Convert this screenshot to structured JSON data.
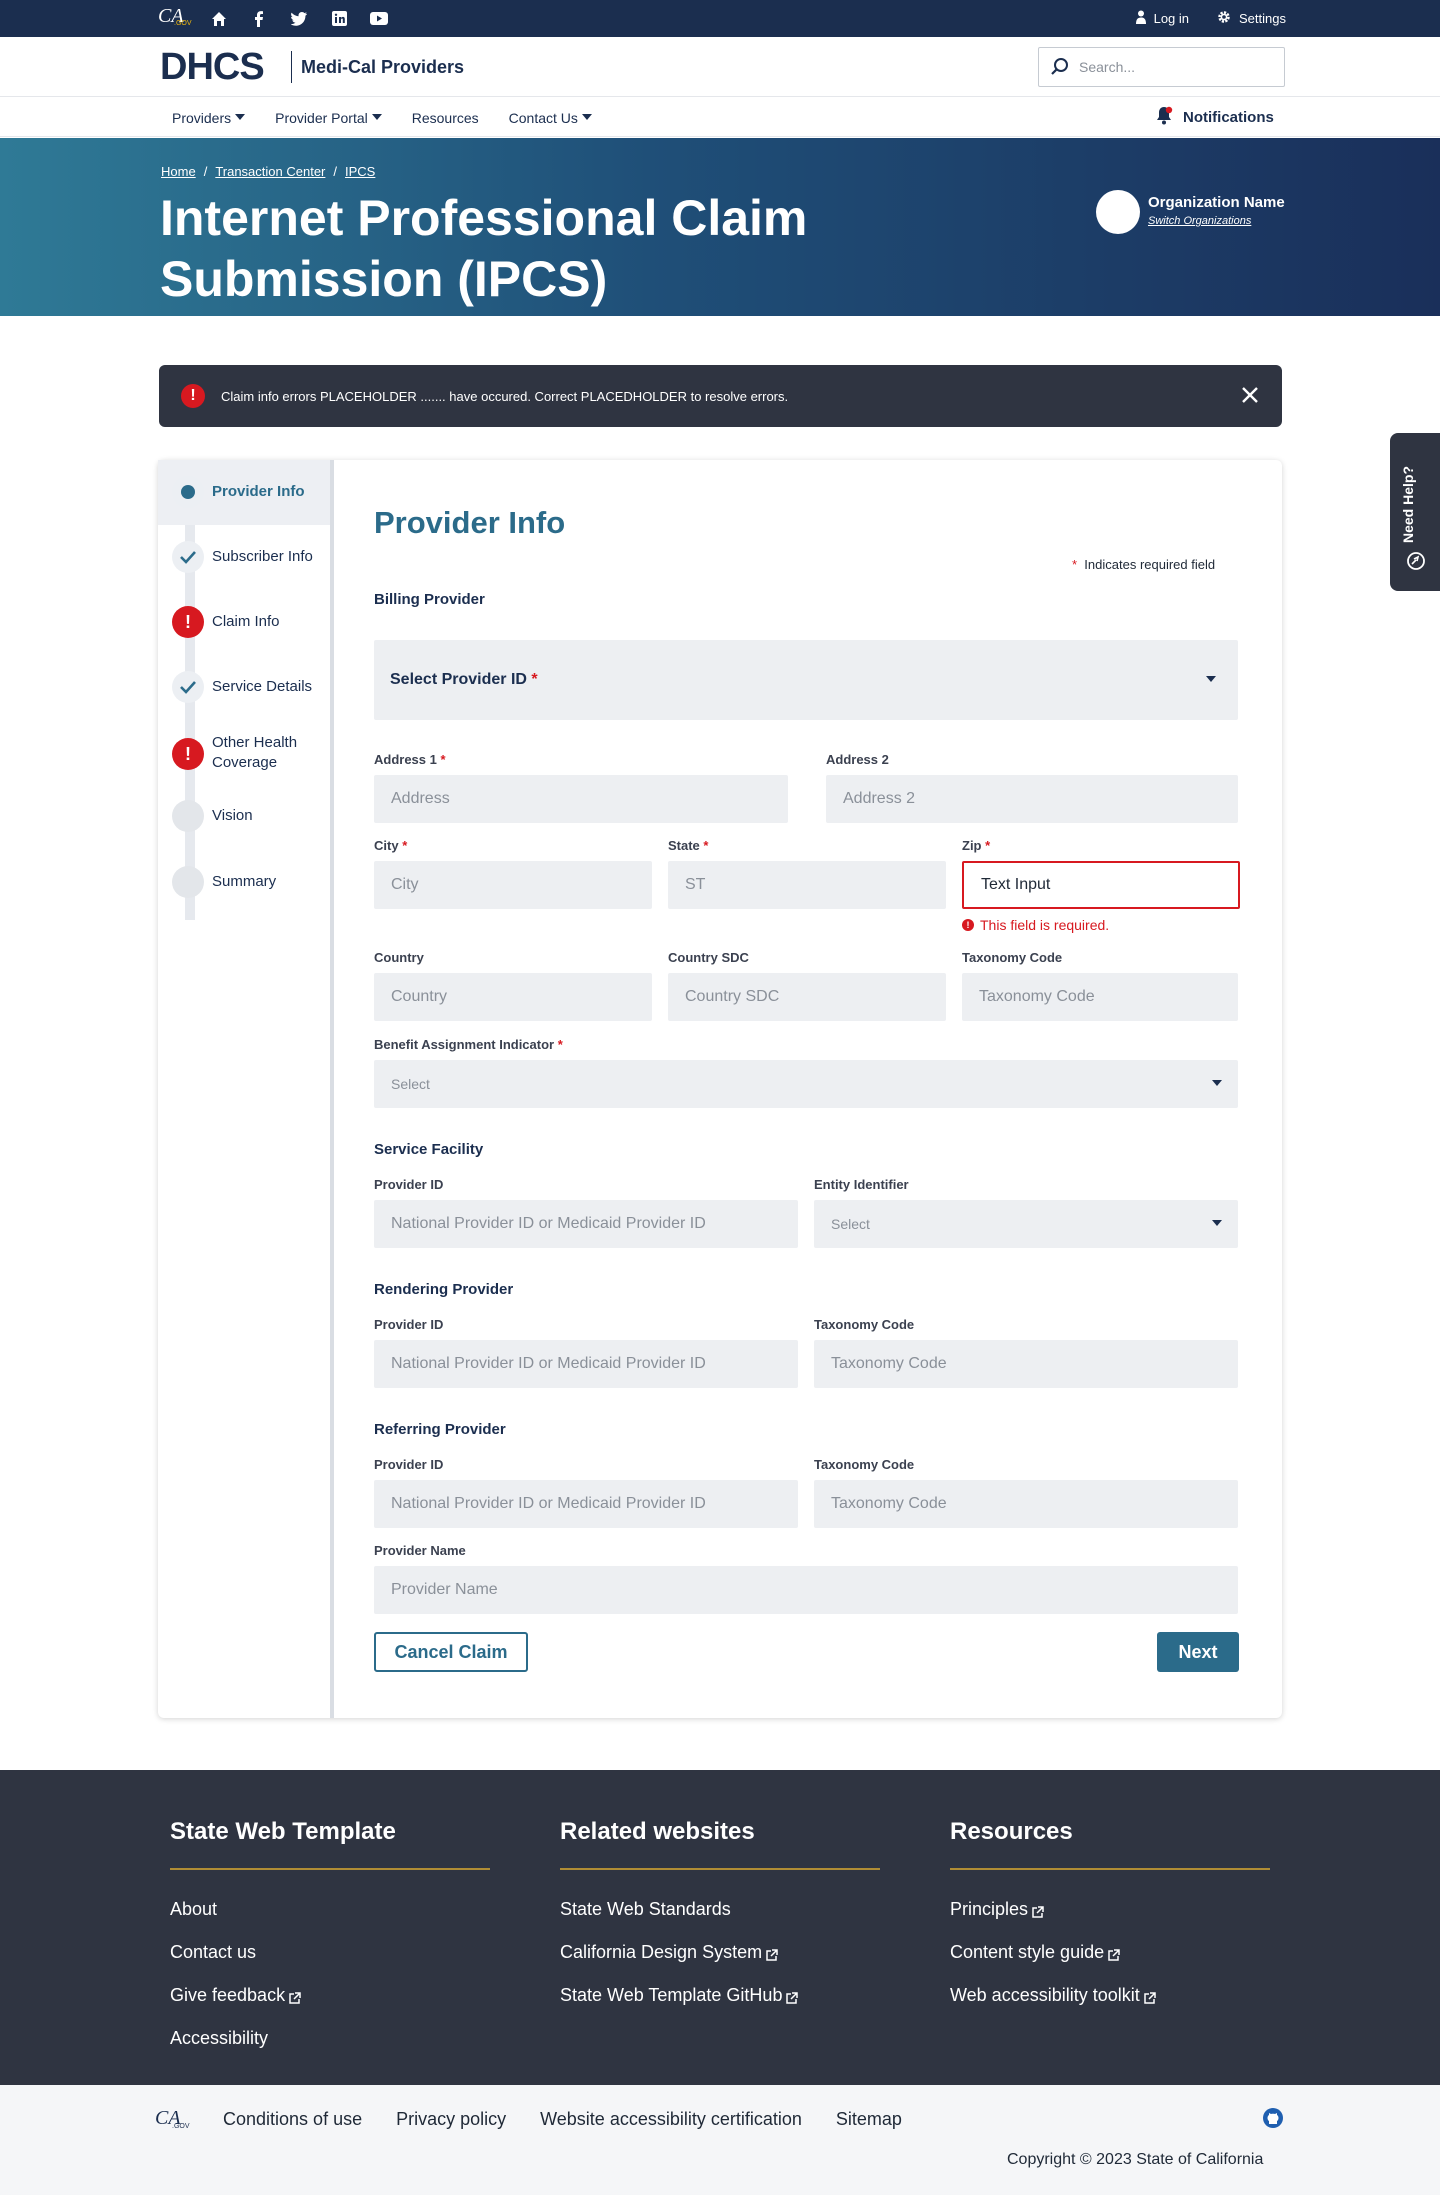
{
  "utility": {
    "logo_text": "CA",
    "logo_sub": ".GOV",
    "icons": [
      "home-icon",
      "facebook-icon",
      "twitter-icon",
      "linkedin-icon",
      "youtube-icon"
    ],
    "login_label": "Log in",
    "settings_label": "Settings"
  },
  "brand": {
    "logo": "DHCS",
    "title": "Medi-Cal Providers",
    "search_placeholder": "Search..."
  },
  "nav": {
    "items": [
      {
        "label": "Providers",
        "dropdown": true
      },
      {
        "label": "Provider Portal",
        "dropdown": true
      },
      {
        "label": "Resources",
        "dropdown": false
      },
      {
        "label": "Contact Us",
        "dropdown": true
      }
    ],
    "notifications_label": "Notifications"
  },
  "hero": {
    "breadcrumbs": [
      "Home",
      "Transaction Center",
      "IPCS"
    ],
    "breadcrumb_sep": "/",
    "title": "Internet Professional Claim Submission (IPCS)",
    "org_name": "Organization Name",
    "org_switch": "Switch Organizations"
  },
  "alert": {
    "text": "Claim info errors PLACEHOLDER ....... have occured. Correct PLACEDHOLDER to resolve errors."
  },
  "need_help": "Need Help?",
  "steps": [
    {
      "label": "Provider Info",
      "state": "current"
    },
    {
      "label": "Subscriber Info",
      "state": "done"
    },
    {
      "label": "Claim Info",
      "state": "error"
    },
    {
      "label": "Service Details",
      "state": "done"
    },
    {
      "label": "Other Health Coverage",
      "state": "error"
    },
    {
      "label": "Vision",
      "state": "idle"
    },
    {
      "label": "Summary",
      "state": "idle"
    }
  ],
  "form": {
    "title": "Provider Info",
    "required_note": "Indicates required field",
    "required_mark": "*",
    "billing": {
      "section": "Billing Provider",
      "provider_select": "Select Provider ID",
      "address1_label": "Address 1",
      "address1_placeholder": "Address",
      "address2_label": "Address 2",
      "address2_placeholder": "Address 2",
      "city_label": "City",
      "city_placeholder": "City",
      "state_label": "State",
      "state_placeholder": "ST",
      "zip_label": "Zip",
      "zip_value": "Text Input",
      "zip_error": "This field is required.",
      "country_label": "Country",
      "country_placeholder": "Country",
      "country_sdc_label": "Country SDC",
      "country_sdc_placeholder": "Country SDC",
      "taxonomy_label": "Taxonomy Code",
      "taxonomy_placeholder": "Taxonomy Code",
      "benefit_label": "Benefit Assignment Indicator",
      "benefit_value": "Select"
    },
    "service_facility": {
      "section": "Service Facility",
      "provider_id_label": "Provider ID",
      "provider_id_placeholder": "National Provider ID or Medicaid Provider ID",
      "entity_label": "Entity Identifier",
      "entity_value": "Select"
    },
    "rendering": {
      "section": "Rendering Provider",
      "provider_id_label": "Provider ID",
      "provider_id_placeholder": "National Provider ID or Medicaid Provider ID",
      "taxonomy_label": "Taxonomy Code",
      "taxonomy_placeholder": "Taxonomy Code"
    },
    "referring": {
      "section": "Referring Provider",
      "provider_id_label": "Provider ID",
      "provider_id_placeholder": "National Provider ID or Medicaid Provider ID",
      "taxonomy_label": "Taxonomy Code",
      "taxonomy_placeholder": "Taxonomy Code",
      "name_label": "Provider Name",
      "name_placeholder": "Provider Name"
    },
    "cancel_label": "Cancel Claim",
    "next_label": "Next"
  },
  "footer": {
    "columns": [
      {
        "title": "State Web Template",
        "links": [
          {
            "label": "About",
            "external": false
          },
          {
            "label": "Contact us",
            "external": false
          },
          {
            "label": "Give feedback",
            "external": true
          },
          {
            "label": "Accessibility",
            "external": false
          }
        ]
      },
      {
        "title": "Related websites",
        "links": [
          {
            "label": "State Web Standards",
            "external": false
          },
          {
            "label": "California Design System",
            "external": true
          },
          {
            "label": "State Web Template GitHub",
            "external": true
          }
        ]
      },
      {
        "title": "Resources",
        "links": [
          {
            "label": "Principles",
            "external": true
          },
          {
            "label": "Content style guide",
            "external": true
          },
          {
            "label": "Web accessibility toolkit",
            "external": true
          }
        ]
      }
    ],
    "bottom_links": [
      "Conditions of use",
      "Privacy policy",
      "Website accessibility certification",
      "Sitemap"
    ],
    "copyright": "Copyright © 2023  State of California"
  },
  "colors": {
    "navy": "#1b2e4f",
    "teal": "#2b6b8a",
    "error": "#d71920",
    "footer_bg": "#2f3441",
    "accent_gold": "#b08d35"
  }
}
